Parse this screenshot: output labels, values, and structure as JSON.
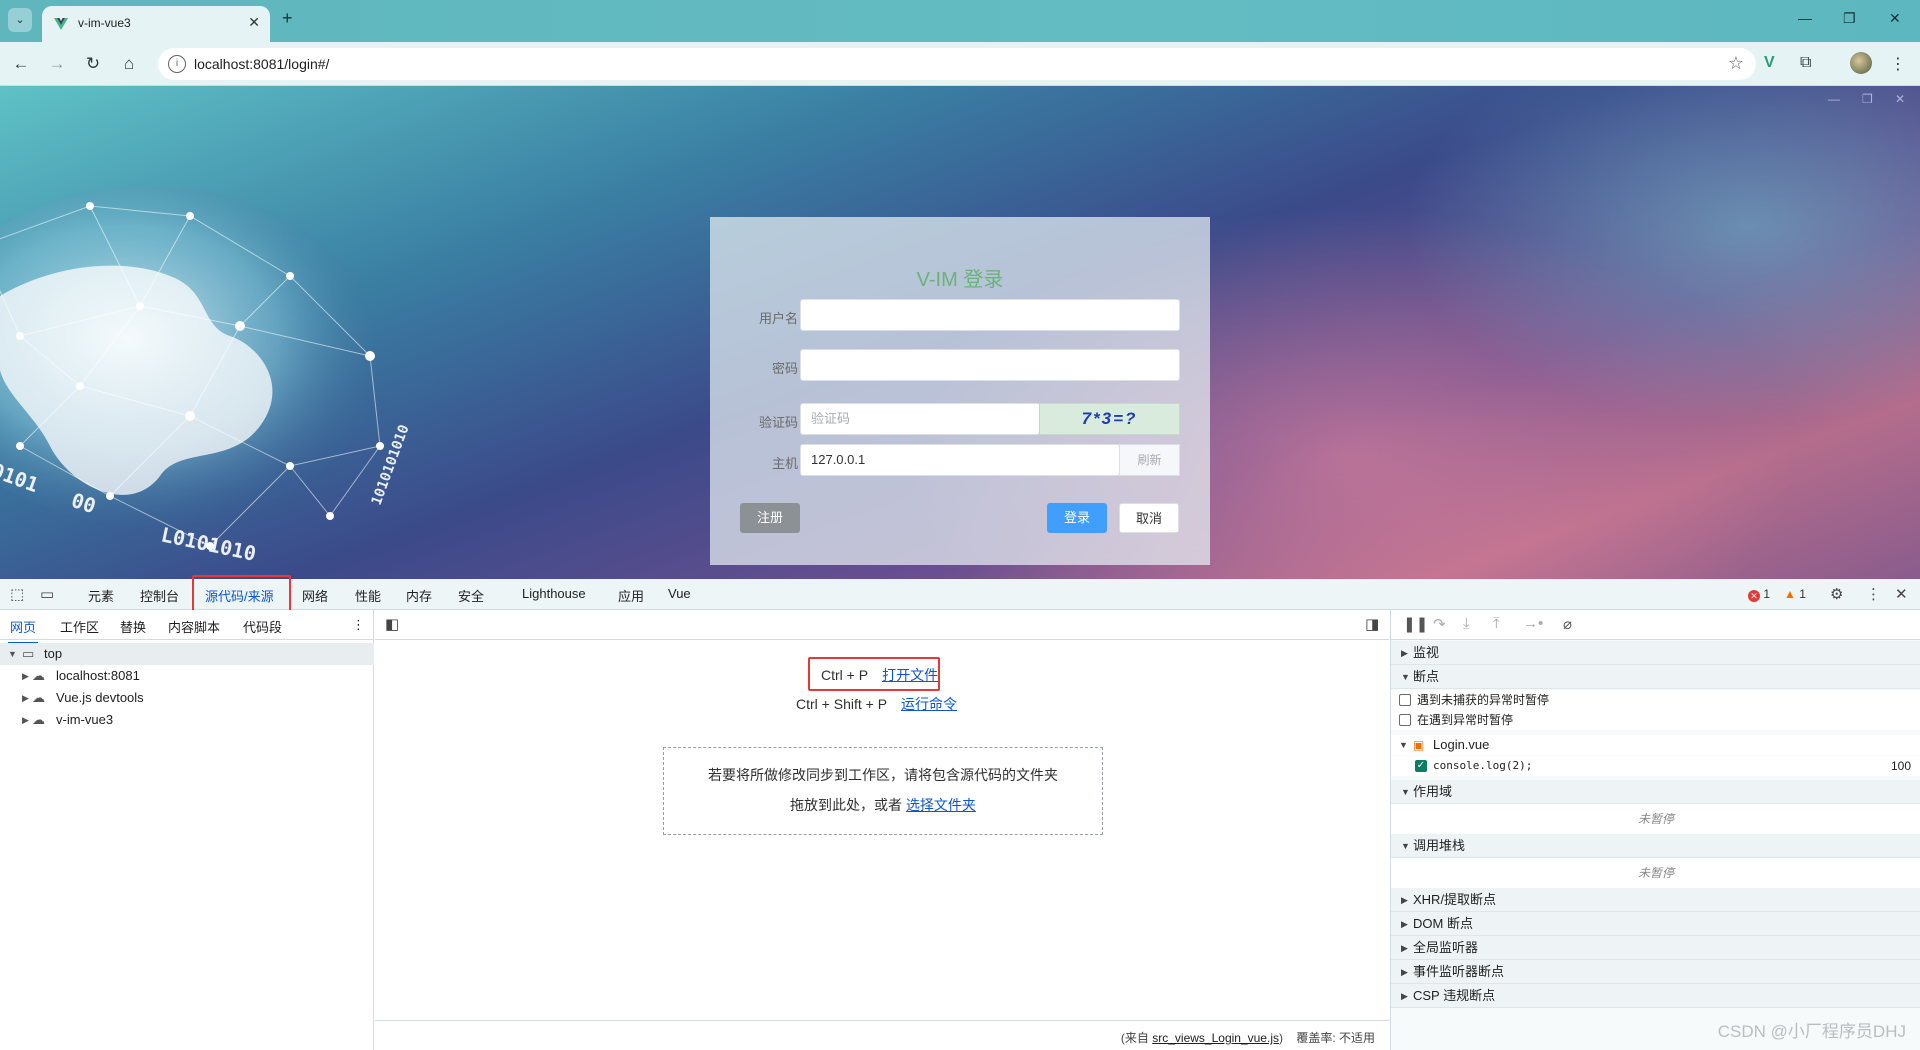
{
  "browser": {
    "tab_title": "v-im-vue3",
    "tab_close": "✕",
    "new_tab": "+",
    "url": "localhost:8081/login#/"
  },
  "login": {
    "title": "V-IM 登录",
    "username_label": "用户名",
    "password_label": "密码",
    "captcha_label": "验证码",
    "captcha_placeholder": "验证码",
    "captcha_text": "7*3=?",
    "host_label": "主机",
    "host_value": "127.0.0.1",
    "refresh": "刷新",
    "register": "注册",
    "login": "登录",
    "cancel": "取消"
  },
  "devtools": {
    "tabs": [
      "元素",
      "控制台",
      "源代码/来源",
      "网络",
      "性能",
      "内存",
      "安全",
      "Lighthouse",
      "应用",
      "Vue"
    ],
    "errors": "1",
    "warnings": "1",
    "nav_tabs": [
      "网页",
      "工作区",
      "替换",
      "内容脚本",
      "代码段"
    ],
    "tree": [
      "top",
      "localhost:8081",
      "Vue.js devtools",
      "v-im-vue3"
    ],
    "shortcut1_keys": "Ctrl + P",
    "shortcut1_action": "打开文件",
    "shortcut2_keys": "Ctrl + Shift + P",
    "shortcut2_action": "运行命令",
    "drop_line1": "若要将所做修改同步到工作区，请将包含源代码的文件夹",
    "drop_line2": "拖放到此处，或者",
    "drop_link": "选择文件夹",
    "status_prefix": "(来自",
    "status_file": "src_views_Login_vue.js",
    "status_suffix": ")",
    "coverage": "覆盖率: 不适用",
    "debug": {
      "watch": "监视",
      "breakpoints": "断点",
      "pause_uncaught": "遇到未捕获的异常时暂停",
      "pause_caught": "在遇到异常时暂停",
      "file": "Login.vue",
      "bp_code": "console.log(2);",
      "bp_line": "100",
      "scope": "作用域",
      "not_paused": "未暂停",
      "callstack": "调用堆栈",
      "xhr": "XHR/提取断点",
      "dom": "DOM 断点",
      "global": "全局监听器",
      "event": "事件监听器断点",
      "csp": "CSP 违规断点"
    }
  },
  "watermark": "CSDN @小厂程序员DHJ"
}
